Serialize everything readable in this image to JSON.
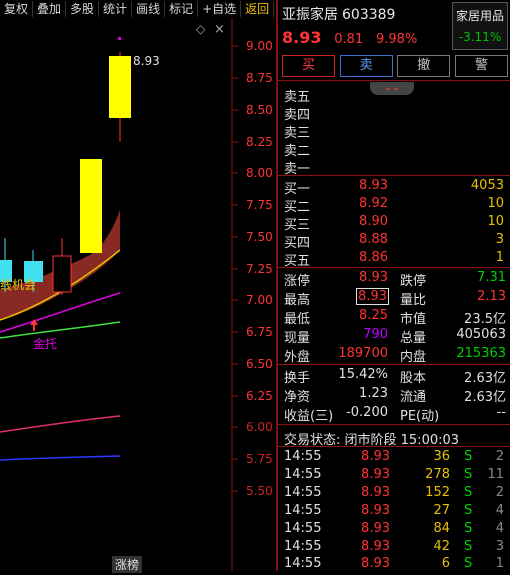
{
  "toolbar": {
    "items": [
      "复权",
      "叠加",
      "多股",
      "统计",
      "画线",
      "标记",
      "+自选",
      "返回"
    ]
  },
  "chart": {
    "y_ticks": [
      "9.00",
      "8.75",
      "8.50",
      "8.25",
      "8.00",
      "7.75",
      "7.50",
      "7.25",
      "7.00",
      "6.75",
      "6.50",
      "6.25",
      "6.00",
      "5.75",
      "5.50"
    ],
    "high_label": "8.93",
    "overlay_text": "线机会",
    "arrow_label": "金托",
    "diamond": "◇",
    "corner_close": "×",
    "bottom_tag": "涨榜"
  },
  "stock": {
    "name": "亚振家居",
    "code": "603389",
    "price": "8.93",
    "change": "0.81",
    "pct": "9.98%"
  },
  "industry": {
    "name": "家居用品",
    "change": "-3.11%"
  },
  "buttons": {
    "buy": "买",
    "sell": "卖",
    "cancel": "撤",
    "alert": "警"
  },
  "collapse_icon": "⌄⌄",
  "asks": [
    {
      "label": "卖五",
      "price": "",
      "vol": ""
    },
    {
      "label": "卖四",
      "price": "",
      "vol": ""
    },
    {
      "label": "卖三",
      "price": "",
      "vol": ""
    },
    {
      "label": "卖二",
      "price": "",
      "vol": ""
    },
    {
      "label": "卖一",
      "price": "",
      "vol": ""
    }
  ],
  "bids": [
    {
      "label": "买一",
      "price": "8.93",
      "vol": "4053"
    },
    {
      "label": "买二",
      "price": "8.92",
      "vol": "10"
    },
    {
      "label": "买三",
      "price": "8.90",
      "vol": "10"
    },
    {
      "label": "买四",
      "price": "8.88",
      "vol": "3"
    },
    {
      "label": "买五",
      "price": "8.86",
      "vol": "1"
    }
  ],
  "quote": {
    "limit_up_l": "涨停",
    "limit_up": "8.93",
    "limit_down_l": "跌停",
    "limit_down": "7.31",
    "high_l": "最高",
    "high": "8.93",
    "vol_ratio_l": "量比",
    "vol_ratio": "2.13",
    "low_l": "最低",
    "low": "8.25",
    "mktcap_l": "市值",
    "mktcap": "23.5亿",
    "cur_vol_l": "现量",
    "cur_vol": "790",
    "total_vol_l": "总量",
    "total_vol": "405063",
    "outer_l": "外盘",
    "outer": "189700",
    "inner_l": "内盘",
    "inner": "215363",
    "turnover_l": "换手",
    "turnover": "15.42%",
    "equity_l": "股本",
    "equity": "2.63亿",
    "nav_l": "净资",
    "nav": "1.23",
    "float_l": "流通",
    "float": "2.63亿",
    "eps_l": "收益(三)",
    "eps": "-0.200",
    "pe_l": "PE(动)",
    "pe": "--"
  },
  "status": "交易状态: 闭市阶段 15:00:03",
  "ticks": [
    {
      "time": "14:55",
      "price": "8.93",
      "vol": "36",
      "side": "S",
      "n": "2"
    },
    {
      "time": "14:55",
      "price": "8.93",
      "vol": "278",
      "side": "S",
      "n": "11"
    },
    {
      "time": "14:55",
      "price": "8.93",
      "vol": "152",
      "side": "S",
      "n": "2"
    },
    {
      "time": "14:55",
      "price": "8.93",
      "vol": "27",
      "side": "S",
      "n": "4"
    },
    {
      "time": "14:55",
      "price": "8.93",
      "vol": "84",
      "side": "S",
      "n": "4"
    },
    {
      "time": "14:55",
      "price": "8.93",
      "vol": "42",
      "side": "S",
      "n": "3"
    },
    {
      "time": "14:55",
      "price": "8.93",
      "vol": "6",
      "side": "S",
      "n": "1"
    }
  ]
}
